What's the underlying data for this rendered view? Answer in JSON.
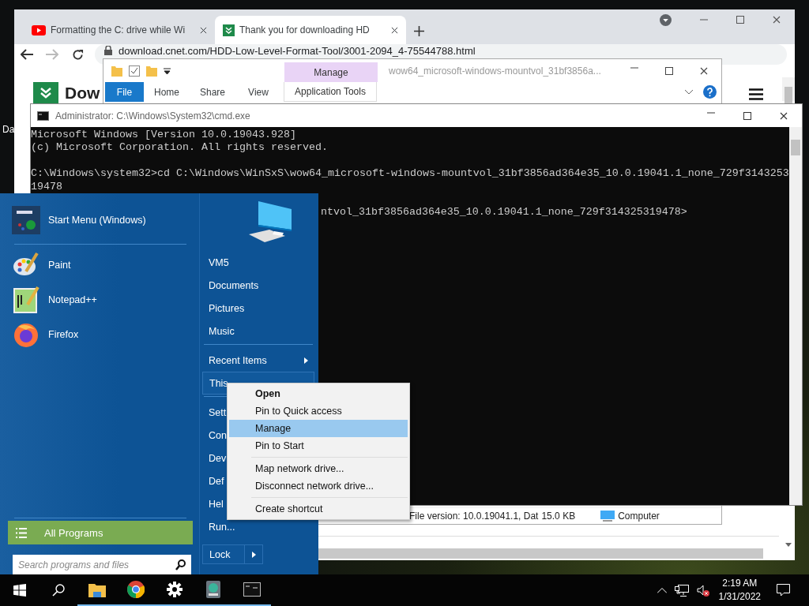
{
  "desktop": {
    "icon_label": "Da"
  },
  "browser": {
    "tabs": [
      {
        "title": "Formatting the C: drive while Wi",
        "kind": "video",
        "selected": false
      },
      {
        "title": "Thank you for downloading HD",
        "kind": "download",
        "selected": true
      }
    ],
    "url": "download.cnet.com/HDD-Low-Level-Format-Tool/3001-2094_4-75544788.html",
    "page_logo": "Dow"
  },
  "explorer": {
    "context_tab": "Manage",
    "title": "wow64_microsoft-windows-mountvol_31bf3856a...",
    "ribbon_tabs": [
      {
        "label": "File",
        "kind": "file"
      },
      {
        "label": "Home",
        "kind": "tab"
      },
      {
        "label": "Share",
        "kind": "tab"
      },
      {
        "label": "View",
        "kind": "tab"
      },
      {
        "label": "Application Tools",
        "kind": "contextual"
      }
    ],
    "status_bar": {
      "details": "File version: 10.0.19041.1, Dat",
      "size": "15.0 KB",
      "location": "Computer"
    }
  },
  "console": {
    "title": "Administrator: C:\\Windows\\System32\\cmd.exe",
    "blocks": [
      {
        "kind": "full",
        "lines": [
          "Microsoft Windows [Version 10.0.19043.928]",
          "(c) Microsoft Corporation. All rights reserved."
        ]
      },
      {
        "kind": "full",
        "lines": [
          "C:\\Windows\\system32>cd C:\\Windows\\WinSxS\\wow64_microsoft-windows-mountvol_31bf3856ad364e35_10.0.19041.1_none_729f3143253",
          "19478"
        ]
      },
      {
        "kind": "partial",
        "lines": [
          "ntvol_31bf3856ad364e35_10.0.19041.1_none_729f314325319478>"
        ]
      }
    ]
  },
  "start_menu": {
    "pinned": [
      {
        "label": "Start Menu (Windows)",
        "kind": "start"
      },
      {
        "label": "Paint",
        "kind": "paint"
      },
      {
        "label": "Notepad++",
        "kind": "notepad"
      },
      {
        "label": "Firefox",
        "kind": "firefox"
      }
    ],
    "all_programs": "All Programs",
    "search": {
      "placeholder": "Search programs and files"
    },
    "right_groups": [
      {
        "items": [
          {
            "label": "VM5",
            "kind": "link",
            "selected": false
          },
          {
            "label": "Documents",
            "kind": "link",
            "selected": false
          },
          {
            "label": "Pictures",
            "kind": "link",
            "selected": false
          },
          {
            "label": "Music",
            "kind": "link",
            "selected": false
          }
        ]
      },
      {
        "items": [
          {
            "label": "Recent Items",
            "kind": "submenu",
            "selected": false
          },
          {
            "label": "This",
            "kind": "link",
            "selected": true
          }
        ]
      },
      {
        "items": [
          {
            "label": "Sett",
            "kind": "link",
            "selected": false
          },
          {
            "label": "Con",
            "kind": "link",
            "selected": false
          },
          {
            "label": "Dev",
            "kind": "link",
            "selected": false
          },
          {
            "label": "Def",
            "kind": "link",
            "selected": false
          },
          {
            "label": "Hel",
            "kind": "link",
            "selected": false
          },
          {
            "label": "Run...",
            "kind": "link",
            "selected": false
          }
        ]
      }
    ],
    "power_button": "Lock"
  },
  "context_menu": {
    "groups": [
      {
        "items": [
          {
            "label": "Open",
            "default": true,
            "selected": false
          },
          {
            "label": "Pin to Quick access",
            "default": false,
            "selected": false
          },
          {
            "label": "Manage",
            "default": false,
            "selected": true
          },
          {
            "label": "Pin to Start",
            "default": false,
            "selected": false
          }
        ]
      },
      {
        "items": [
          {
            "label": "Map network drive...",
            "default": false,
            "selected": false
          },
          {
            "label": "Disconnect network drive...",
            "default": false,
            "selected": false
          }
        ]
      },
      {
        "items": [
          {
            "label": "Create shortcut",
            "default": false,
            "selected": false
          }
        ]
      }
    ]
  },
  "taskbar": {
    "apps": [
      {
        "kind": "explorer",
        "running": true
      },
      {
        "kind": "chrome",
        "running": true
      },
      {
        "kind": "settings",
        "running": true
      },
      {
        "kind": "disk",
        "running": true
      },
      {
        "kind": "console",
        "running": true
      }
    ],
    "time": "2:19 AM",
    "date": "1/31/2022"
  }
}
